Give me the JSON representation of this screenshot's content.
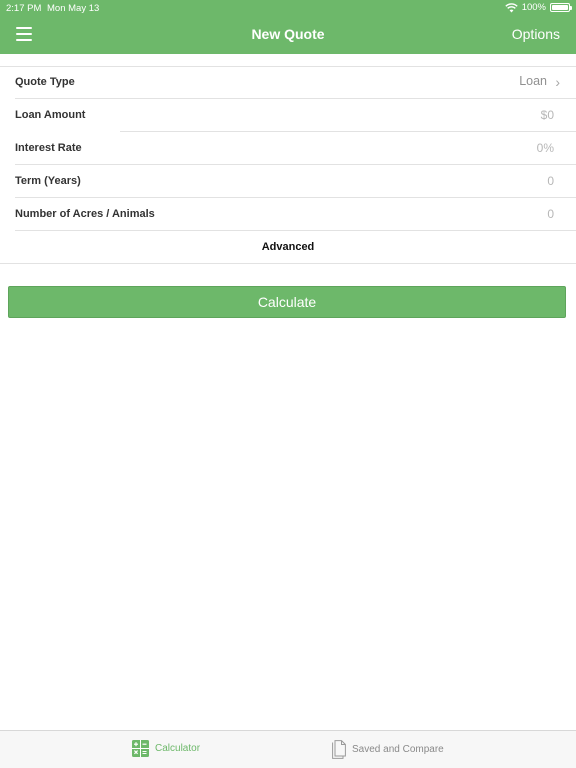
{
  "status_bar": {
    "time": "2:17 PM",
    "date": "Mon May 13",
    "battery": "100%",
    "battery_level": 1.0
  },
  "nav": {
    "title": "New Quote",
    "options_label": "Options"
  },
  "form": {
    "rows": [
      {
        "label": "Quote Type",
        "value": "Loan"
      },
      {
        "label": "Loan Amount",
        "placeholder": "$0"
      },
      {
        "label": "Interest Rate",
        "placeholder": "0%"
      },
      {
        "label": "Term (Years)",
        "placeholder": "0"
      },
      {
        "label": "Number of Acres / Animals",
        "placeholder": "0"
      }
    ],
    "advanced_label": "Advanced"
  },
  "calculate_label": "Calculate",
  "tabs": [
    {
      "label": "Calculator",
      "icon": "calculator-icon",
      "selected": true
    },
    {
      "label": "Saved and Compare",
      "icon": "document-icon",
      "selected": false
    }
  ],
  "colors": {
    "accent": "#6db86a",
    "placeholder": "#b7b7b7",
    "separator": "#e2e2e2"
  }
}
